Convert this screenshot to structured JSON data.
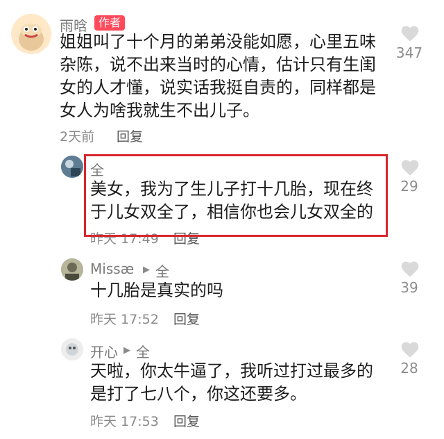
{
  "comments": [
    {
      "user": "雨晗",
      "badge": "作者",
      "text": "姐姐叫了十个月的弟弟没能如愿，心里五味杂陈，说不出来当时的心情，估计只有生闺女的人才懂，说实话我挺自责的，同样都是女人为啥我就生不出儿子。",
      "time": "2天前",
      "reply": "回复",
      "likes": "347"
    },
    {
      "user": "全",
      "text": "美女，我为了生儿子打十几胎，现在终于儿女双全了，相信你也会儿女双全的",
      "time": "昨天 17:49",
      "reply": "回复",
      "likes": "29"
    },
    {
      "user": "Missæ",
      "arrow": "▶",
      "reply_to": "全",
      "text": "十几胎是真实的吗",
      "time": "昨天 17:52",
      "reply": "回复",
      "likes": "39"
    },
    {
      "user": "开心",
      "arrow": "▶",
      "reply_to": "全",
      "text": "天啦，你太牛逼了，我听过打过最多的是打了七八个，你这还要多。",
      "time": "昨天 17:53",
      "reply": "回复",
      "likes": "28"
    }
  ],
  "icons": {
    "like": "heart-icon"
  },
  "colors": {
    "badge": "#ff4a5c",
    "highlight": "#d7262e"
  }
}
